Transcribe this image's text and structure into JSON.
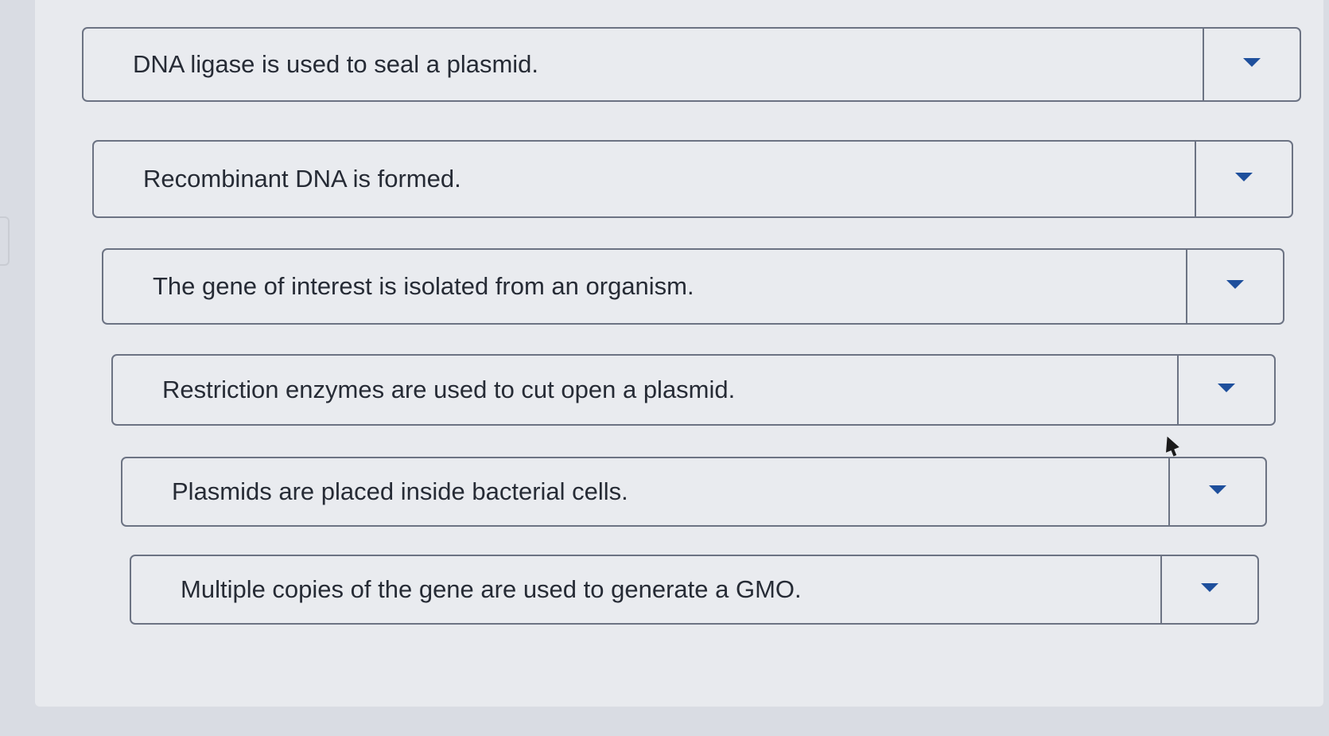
{
  "items": [
    {
      "label": "DNA ligase is used to seal a plasmid."
    },
    {
      "label": "Recombinant DNA is formed."
    },
    {
      "label": "The gene of interest is isolated from an organism."
    },
    {
      "label": "Restriction enzymes are used to cut open a plasmid."
    },
    {
      "label": "Plasmids are placed inside bacterial cells."
    },
    {
      "label": "Multiple copies of the gene are used to generate a GMO."
    }
  ],
  "colors": {
    "background": "#d9dce3",
    "panel": "#e8eaee",
    "border": "#6c7383",
    "text": "#262b35",
    "caret": "#1e4f9c"
  },
  "icons": {
    "dropdown": "caret-down-icon",
    "pointer": "mouse-cursor-icon"
  }
}
